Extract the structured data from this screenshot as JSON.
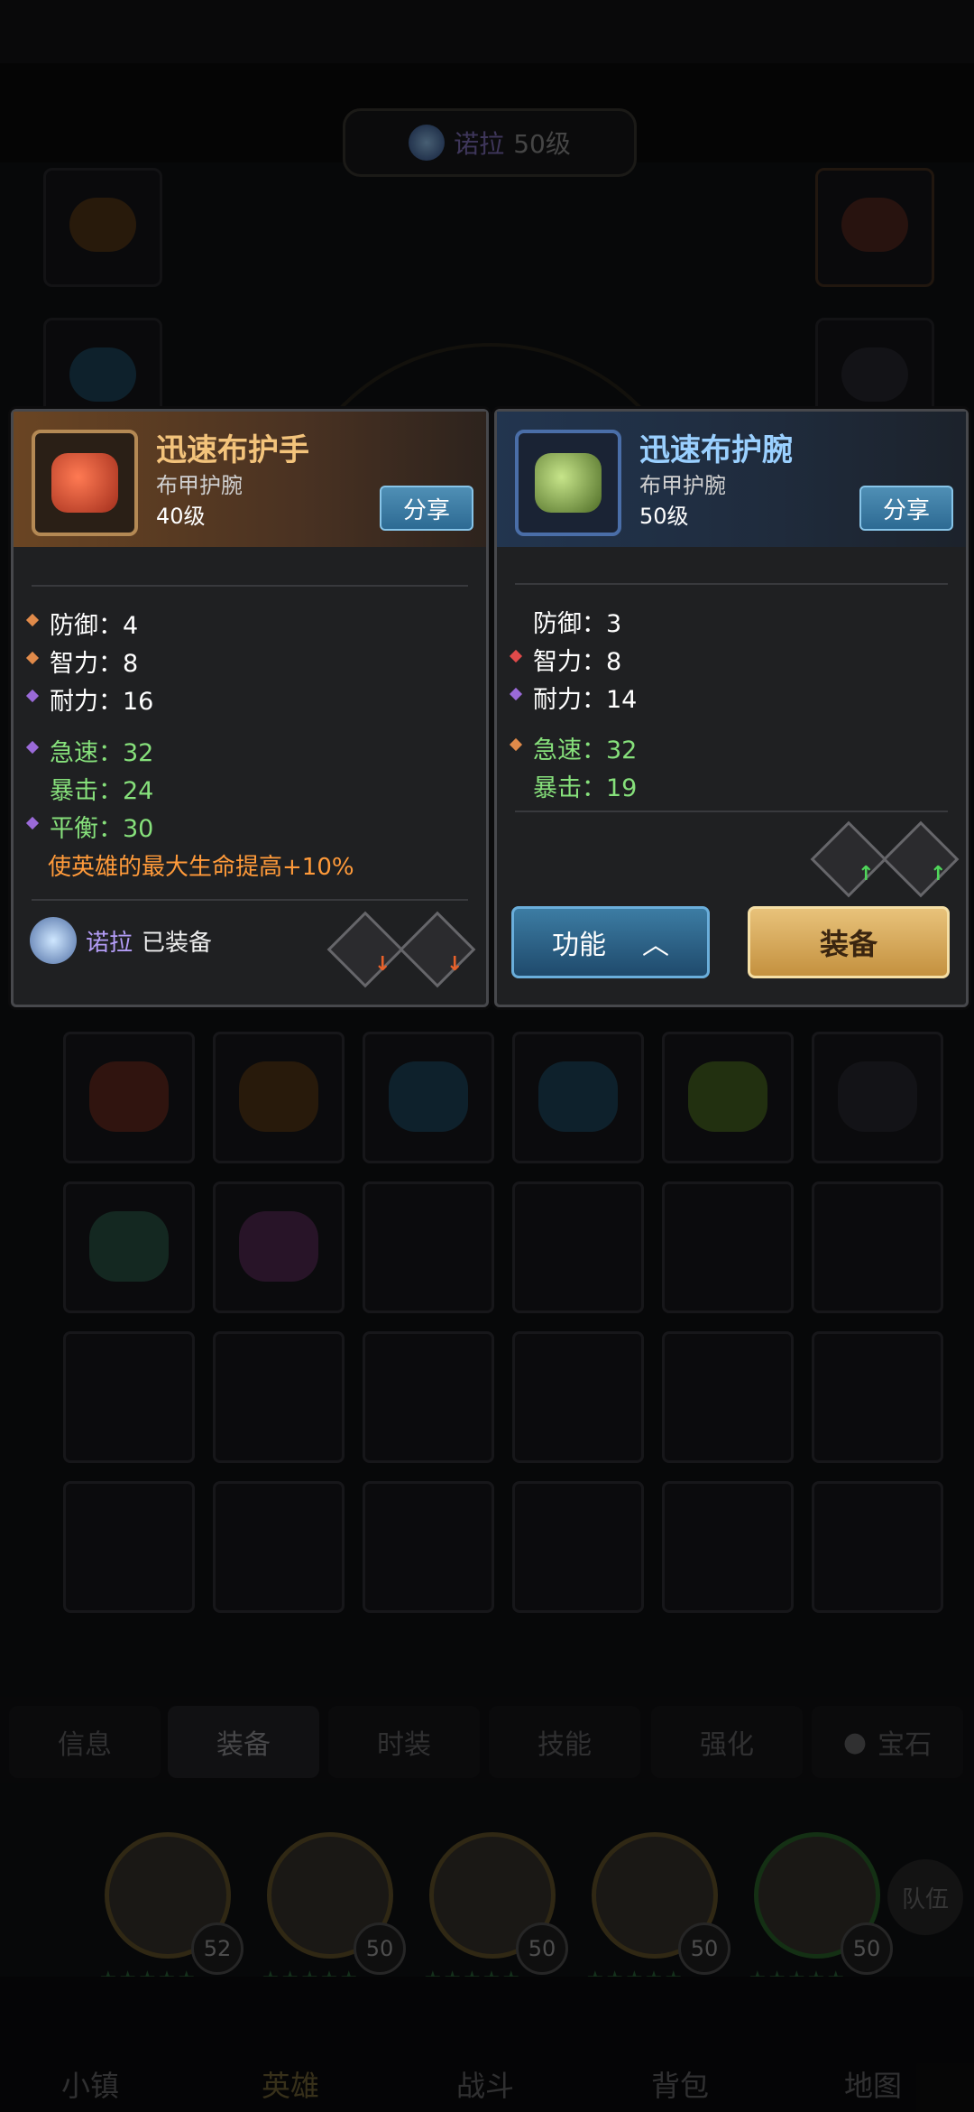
{
  "header": {
    "hero_name": "诺拉",
    "hero_level": "50级"
  },
  "left_item": {
    "name": "迅速布护手",
    "type": "布甲护腕",
    "level": "40级",
    "share_label": "分享",
    "stats": [
      {
        "label": "防御：",
        "value": "4",
        "bullet": "orange",
        "green": false
      },
      {
        "label": "智力：",
        "value": "8",
        "bullet": "orange",
        "green": false
      },
      {
        "label": "耐力：",
        "value": "16",
        "bullet": "purple",
        "green": false
      },
      {
        "label": "急速：",
        "value": "32",
        "bullet": "purple",
        "green": true
      },
      {
        "label": "暴击：",
        "value": "24",
        "bullet": "",
        "green": true
      },
      {
        "label": "平衡：",
        "value": "30",
        "bullet": "purple",
        "green": true
      }
    ],
    "special": "使英雄的最大生命提高+10%",
    "equipped_by": "诺拉",
    "equipped_label": "已装备",
    "compare_arrows": [
      "down",
      "down"
    ]
  },
  "right_item": {
    "name": "迅速布护腕",
    "type": "布甲护腕",
    "level": "50级",
    "share_label": "分享",
    "stats": [
      {
        "label": "防御：",
        "value": "3",
        "bullet": "",
        "green": false
      },
      {
        "label": "智力：",
        "value": "8",
        "bullet": "red",
        "green": false
      },
      {
        "label": "耐力：",
        "value": "14",
        "bullet": "purple",
        "green": false
      },
      {
        "label": "急速：",
        "value": "32",
        "bullet": "orange",
        "green": true
      },
      {
        "label": "暴击：",
        "value": "19",
        "bullet": "",
        "green": true
      }
    ],
    "function_label": "功能",
    "equip_label": "装备",
    "compare_arrows": [
      "up",
      "up"
    ]
  },
  "tabs": [
    {
      "label": "信息"
    },
    {
      "label": "装备"
    },
    {
      "label": "时装"
    },
    {
      "label": "技能"
    },
    {
      "label": "强化"
    },
    {
      "label": "宝石"
    }
  ],
  "heroes": [
    {
      "level": "52"
    },
    {
      "level": "50"
    },
    {
      "level": "50"
    },
    {
      "level": "50"
    },
    {
      "level": "50"
    }
  ],
  "team_label": "队伍",
  "nav": [
    {
      "label": "小镇"
    },
    {
      "label": "英雄"
    },
    {
      "label": "战斗"
    },
    {
      "label": "背包"
    },
    {
      "label": "地图"
    }
  ],
  "colors": {
    "accent_gold": "#f3c37b",
    "accent_blue": "#9ad0ff",
    "stat_green": "#86e07b",
    "special_orange": "#ff9a3a"
  }
}
